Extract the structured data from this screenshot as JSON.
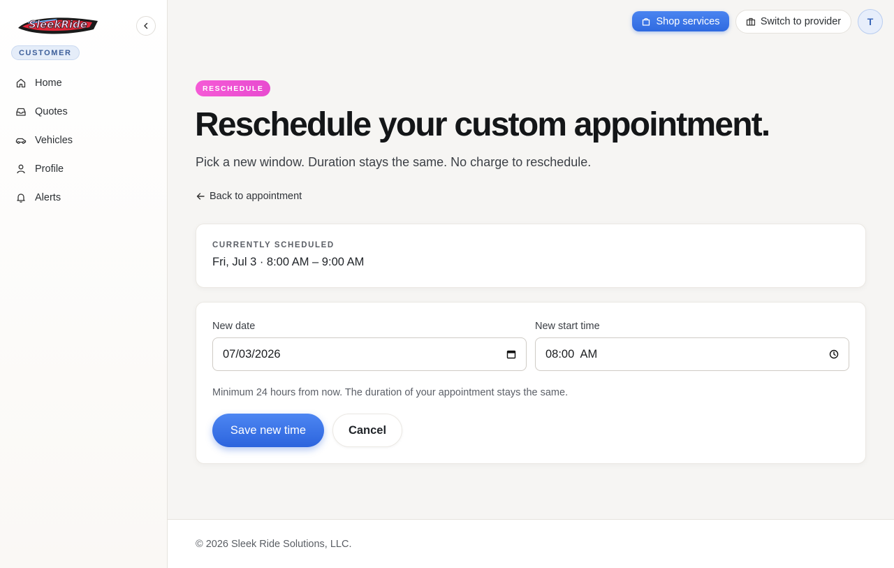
{
  "brand": {
    "logo_text": "SleekRide",
    "colors": {
      "primary": "#2f6ae0",
      "accent_pink": "#f055d5",
      "logo_red": "#e0263a"
    }
  },
  "sidebar": {
    "role_badge": "CUSTOMER",
    "collapse_icon": "chevron-left-icon",
    "items": [
      {
        "label": "Home",
        "icon": "home-icon"
      },
      {
        "label": "Quotes",
        "icon": "inbox-icon"
      },
      {
        "label": "Vehicles",
        "icon": "car-icon"
      },
      {
        "label": "Profile",
        "icon": "user-icon"
      },
      {
        "label": "Alerts",
        "icon": "bell-icon"
      }
    ]
  },
  "topbar": {
    "shop_label": "Shop services",
    "switch_label": "Switch to provider",
    "avatar_initial": "T"
  },
  "main": {
    "pill": "RESCHEDULE",
    "title": "Reschedule your custom appointment.",
    "subtitle": "Pick a new window. Duration stays the same. No charge to reschedule.",
    "back_label": "Back to appointment",
    "current": {
      "label": "CURRENTLY SCHEDULED",
      "value": "Fri, Jul 3 · 8:00 AM – 9:00 AM"
    },
    "form": {
      "date_label": "New date",
      "date_value": "07/03/2026",
      "time_label": "New start time",
      "time_value": "08:00  AM",
      "hint": "Minimum 24 hours from now. The duration of your appointment stays the same.",
      "save_label": "Save new time",
      "cancel_label": "Cancel"
    }
  },
  "footer": {
    "text": "© 2026 Sleek Ride Solutions, LLC."
  }
}
